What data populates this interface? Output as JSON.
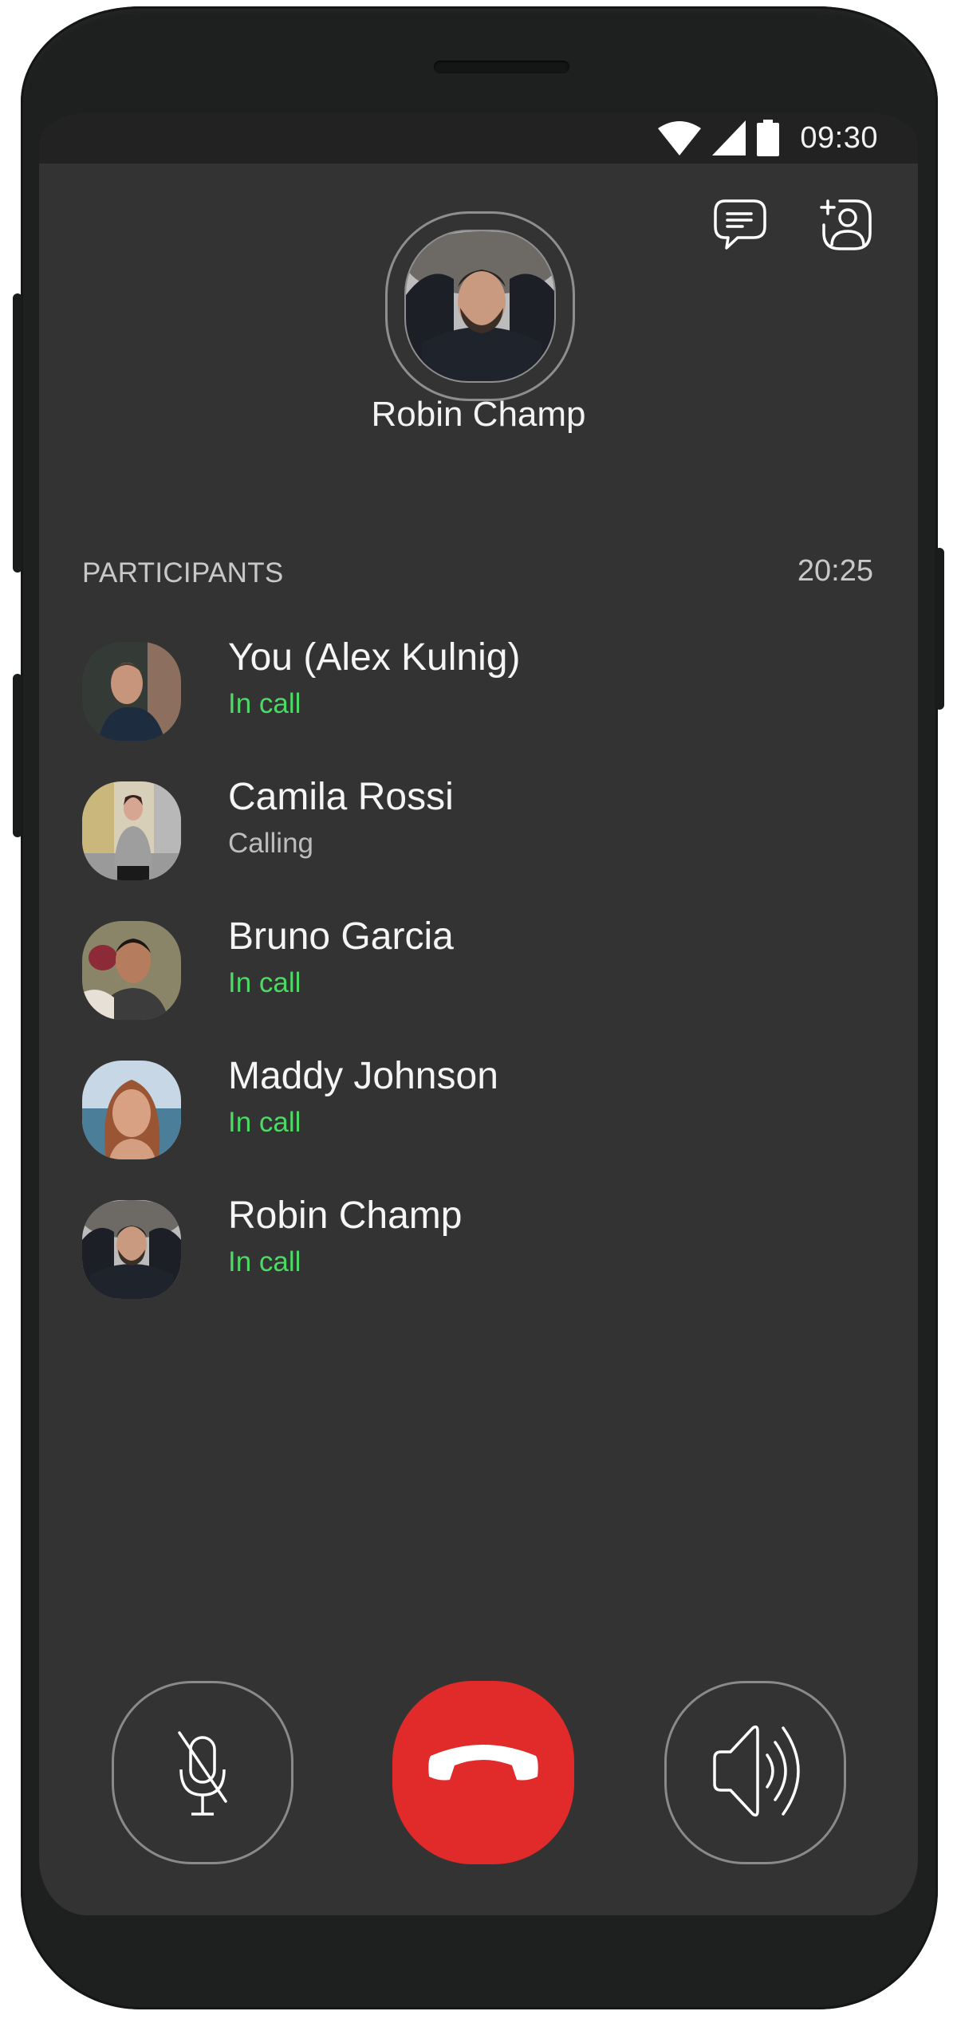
{
  "status_bar": {
    "time": "09:30",
    "icons": [
      "wifi-icon",
      "cellular-signal-icon",
      "battery-icon"
    ]
  },
  "header": {
    "actions": [
      {
        "name": "chat-icon",
        "label": "Chat"
      },
      {
        "name": "add-participant-icon",
        "label": "Add participant"
      }
    ]
  },
  "caller": {
    "name": "Robin Champ"
  },
  "participants_section": {
    "label": "PARTICIPANTS",
    "duration": "20:25"
  },
  "participants": [
    {
      "name": "You (Alex Kulnig)",
      "status": "In call",
      "status_color": "#4cd964"
    },
    {
      "name": "Camila Rossi",
      "status": "Calling",
      "status_color": "#bdbdbd"
    },
    {
      "name": "Bruno Garcia",
      "status": "In call",
      "status_color": "#4cd964"
    },
    {
      "name": "Maddy Johnson",
      "status": "In call",
      "status_color": "#4cd964"
    },
    {
      "name": "Robin Champ",
      "status": "In call",
      "status_color": "#4cd964"
    }
  ],
  "controls": [
    {
      "name": "mute-button",
      "icon": "microphone-off-icon",
      "state": "muted"
    },
    {
      "name": "end-call-button",
      "icon": "phone-hangup-icon",
      "color": "#e12a2a"
    },
    {
      "name": "speaker-button",
      "icon": "speaker-icon"
    }
  ],
  "colors": {
    "background": "#333333",
    "status_bar": "#222222",
    "in_call": "#4cd964",
    "calling": "#bdbdbd",
    "end_call": "#e12a2a"
  }
}
